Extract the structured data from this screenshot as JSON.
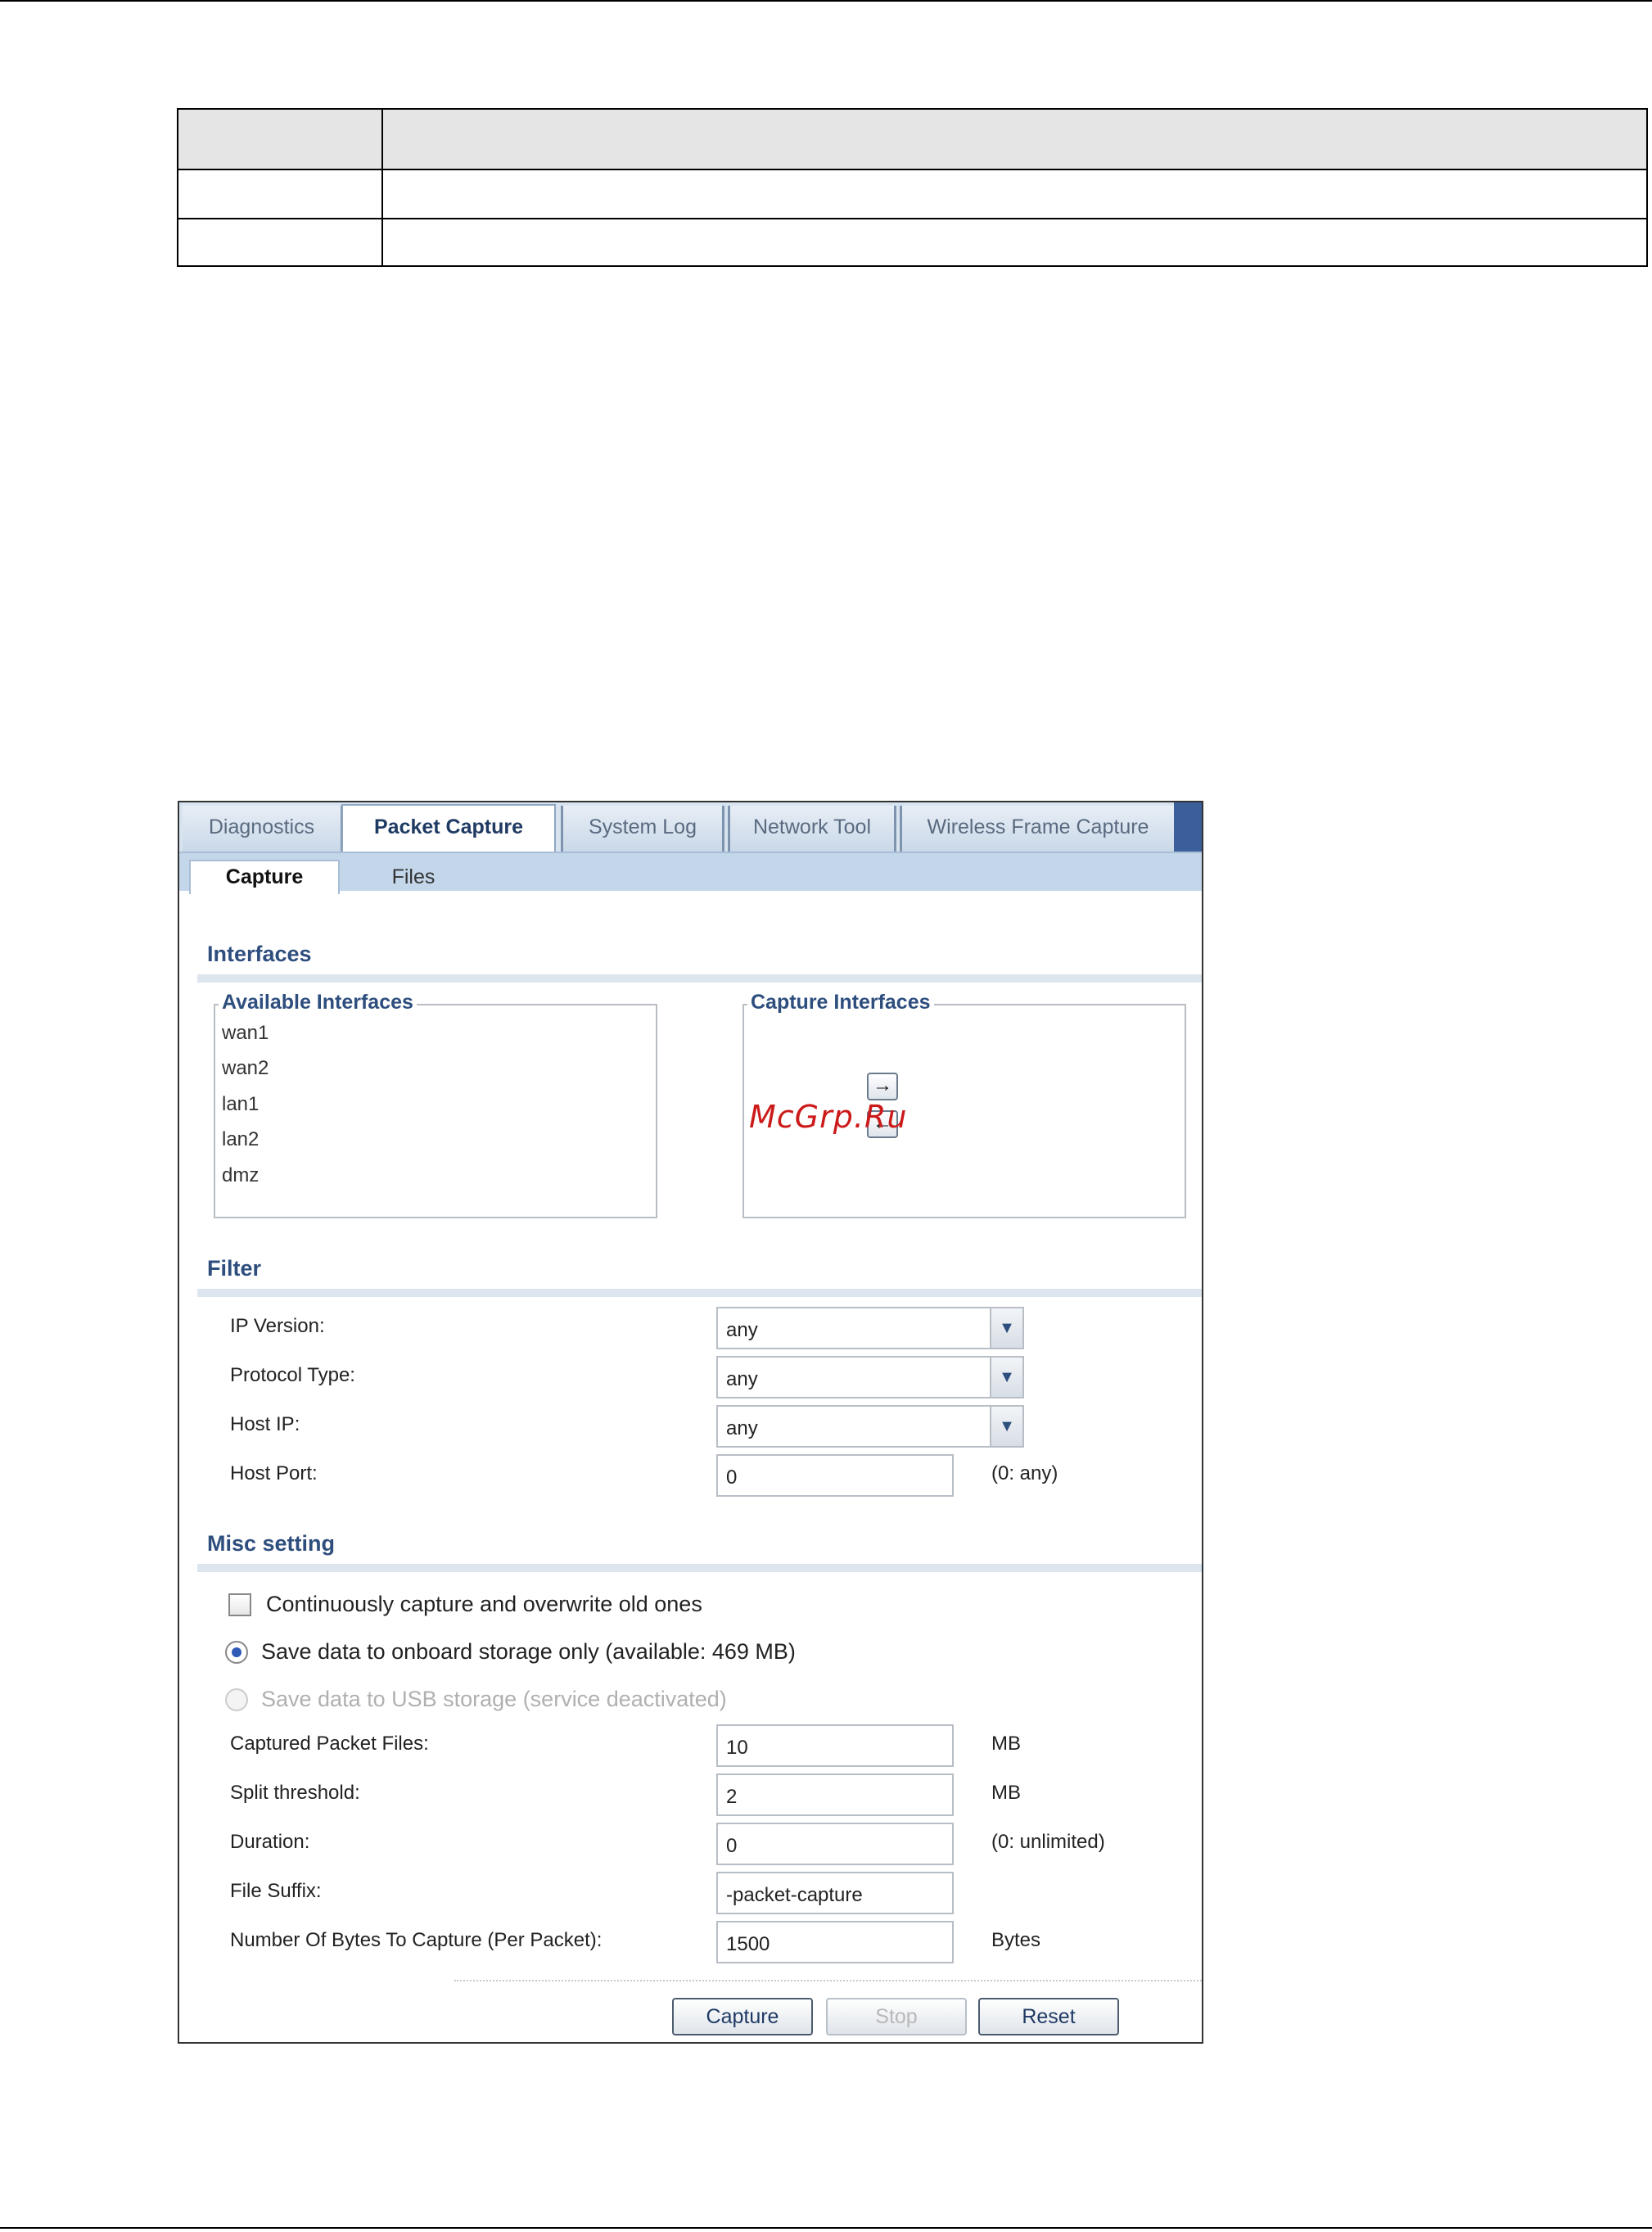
{
  "tabs": [
    "Diagnostics",
    "Packet Capture",
    "System Log",
    "Network Tool",
    "Wireless Frame Capture"
  ],
  "active_tab": "Packet Capture",
  "subtabs": [
    "Capture",
    "Files"
  ],
  "active_subtab": "Capture",
  "interfaces": {
    "title": "Interfaces",
    "available_legend": "Available Interfaces",
    "available": [
      "wan1",
      "wan2",
      "lan1",
      "lan2",
      "dmz"
    ],
    "capture_legend": "Capture Interfaces",
    "capture": [],
    "add_icon": "arrow-right-icon",
    "remove_icon": "arrow-left-icon"
  },
  "watermark": "McGrp.Ru",
  "filter": {
    "title": "Filter",
    "ip_version_label": "IP Version:",
    "ip_version_value": "any",
    "protocol_type_label": "Protocol Type:",
    "protocol_type_value": "any",
    "host_ip_label": "Host IP:",
    "host_ip_value": "any",
    "host_port_label": "Host Port:",
    "host_port_value": "0",
    "host_port_hint": "(0: any)"
  },
  "misc": {
    "title": "Misc setting",
    "continuous_label": "Continuously capture and overwrite old ones",
    "continuous_checked": false,
    "onboard_label": "Save data to onboard storage only (available: 469 MB)",
    "onboard_selected": true,
    "usb_label": "Save data to USB storage (service deactivated)",
    "usb_disabled": true,
    "captured_files_label": "Captured Packet Files:",
    "captured_files_value": "10",
    "captured_files_unit": "MB",
    "split_threshold_label": "Split threshold:",
    "split_threshold_value": "2",
    "split_threshold_unit": "MB",
    "duration_label": "Duration:",
    "duration_value": "0",
    "duration_hint": "(0: unlimited)",
    "file_suffix_label": "File Suffix:",
    "file_suffix_value": "-packet-capture",
    "bytes_label": "Number Of Bytes To Capture (Per Packet):",
    "bytes_value": "1500",
    "bytes_unit": "Bytes"
  },
  "buttons": {
    "capture": "Capture",
    "stop": "Stop",
    "reset": "Reset"
  },
  "colors": {
    "section_title": "#2e4e7e",
    "tab_bar": "#d7e4f0",
    "accent": "#3b5f9a",
    "watermark": "#cc1a1a"
  }
}
